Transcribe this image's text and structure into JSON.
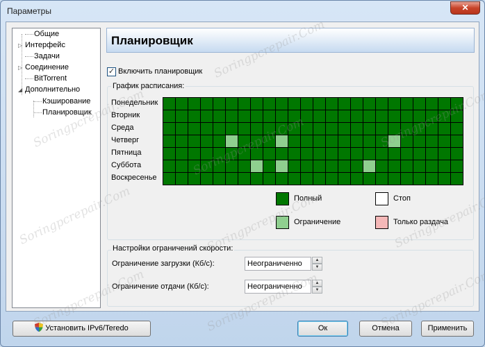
{
  "window": {
    "title": "Параметры",
    "close_glyph": "✕"
  },
  "tree": {
    "items": [
      {
        "label": "Общие",
        "expander": ""
      },
      {
        "label": "Интерфейс",
        "expander": "▷"
      },
      {
        "label": "Задачи",
        "expander": ""
      },
      {
        "label": "Соединение",
        "expander": "▷"
      },
      {
        "label": "BitTorrent",
        "expander": ""
      },
      {
        "label": "Дополнительно",
        "expander": "◢"
      },
      {
        "label": "Кэширование",
        "expander": ""
      },
      {
        "label": "Планировщик",
        "expander": ""
      }
    ]
  },
  "panel": {
    "title": "Планировщик"
  },
  "enable_scheduler": {
    "label": "Включить планировщик",
    "checked": true,
    "check_glyph": "✓"
  },
  "schedule": {
    "group_title": "График расписания:",
    "days": [
      "Понедельник",
      "Вторник",
      "Среда",
      "Четверг",
      "Пятница",
      "Суббота",
      "Воскресенье"
    ],
    "hours": 24,
    "limited_cells": [
      {
        "day": 3,
        "hour": 5
      },
      {
        "day": 3,
        "hour": 9
      },
      {
        "day": 3,
        "hour": 18
      },
      {
        "day": 5,
        "hour": 7
      },
      {
        "day": 5,
        "hour": 9
      },
      {
        "day": 5,
        "hour": 16
      }
    ],
    "legend": {
      "full": {
        "label": "Полный",
        "color": "#007700"
      },
      "stop": {
        "label": "Стоп",
        "color": "#ffffff"
      },
      "limit": {
        "label": "Ограничение",
        "color": "#8fcf8f"
      },
      "seed_only": {
        "label": "Только раздача",
        "color": "#f5b8b8"
      }
    }
  },
  "speed_limits": {
    "group_title": "Настройки ограничений скорости:",
    "download": {
      "label": "Ограничение загрузки (Кб/с):",
      "value": "Неограниченно"
    },
    "upload": {
      "label": "Ограничение отдачи (Кб/с):",
      "value": "Неограниченно"
    },
    "spin_up": "▲",
    "spin_down": "▼"
  },
  "buttons": {
    "ipv6": "Установить IPv6/Teredo",
    "ok": "Ок",
    "cancel": "Отмена",
    "apply": "Применить"
  },
  "watermark": "Soringpcrepair.Com"
}
